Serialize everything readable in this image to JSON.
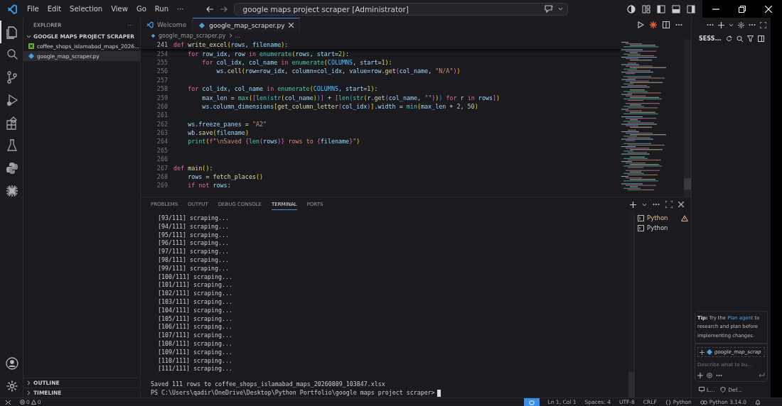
{
  "title_bar": {
    "menus": [
      "File",
      "Edit",
      "Selection",
      "View",
      "Go",
      "Run",
      "···"
    ],
    "search": "google maps project scraper [Administrator]"
  },
  "activity_bar": [
    {
      "kind": "files",
      "selected": true
    },
    {
      "kind": "search",
      "selected": false
    },
    {
      "kind": "branch",
      "selected": false
    },
    {
      "kind": "debug",
      "selected": false
    },
    {
      "kind": "blocks",
      "selected": false
    },
    {
      "kind": "flask",
      "selected": false
    },
    {
      "kind": "snake",
      "selected": false
    },
    {
      "kind": "burst",
      "selected": false
    }
  ],
  "explorer": {
    "title": "EXPLORER",
    "more": "···",
    "folder": {
      "label": "GOOGLE MAPS PROJECT SCRAPER",
      "expanded": true,
      "children": [
        {
          "label": "coffee_shops_islamabad_maps_2026...",
          "kind": "sheet",
          "selected": false
        },
        {
          "label": "google_map_scraper.py",
          "kind": "python",
          "selected": true
        }
      ]
    },
    "sections": [
      {
        "label": "OUTLINE",
        "expanded": false
      },
      {
        "label": "TIMELINE",
        "expanded": false
      }
    ]
  },
  "editor": {
    "tabs": [
      {
        "label": "Welcome",
        "kind": "welcome",
        "selected": false
      },
      {
        "label": "google_map_scraper.py",
        "kind": "python",
        "selected": true
      }
    ],
    "breadcrumb": [
      "google_map_scraper.py",
      "..."
    ],
    "sticky_line": {
      "number": "241",
      "tokens": [
        {
          "text": "def ",
          "kind": "kw"
        },
        {
          "text": "write_excel",
          "kind": "fn"
        },
        {
          "text": "(",
          "kind": "br1"
        },
        {
          "text": "rows",
          "kind": "param"
        },
        {
          "text": ", ",
          "kind": "plain"
        },
        {
          "text": "filename",
          "kind": "param"
        },
        {
          "text": ")",
          "kind": "br1"
        },
        {
          "text": ":",
          "kind": "plain"
        }
      ]
    },
    "lines": [
      {
        "number": "254",
        "tokens": [
          {
            "text": "    for",
            "kind": "kw"
          },
          {
            "text": " row_idx, row ",
            "kind": "var"
          },
          {
            "text": "in",
            "kind": "kw"
          },
          {
            "text": " enumerate",
            "kind": "builtin"
          },
          {
            "text": "(",
            "kind": "br1"
          },
          {
            "text": "rows",
            "kind": "var"
          },
          {
            "text": ", ",
            "kind": "plain"
          },
          {
            "text": "start",
            "kind": "param"
          },
          {
            "text": "=",
            "kind": "plain"
          },
          {
            "text": "2",
            "kind": "num"
          },
          {
            "text": ")",
            "kind": "br1"
          },
          {
            "text": ":",
            "kind": "plain"
          }
        ]
      },
      {
        "number": "255",
        "tokens": [
          {
            "text": "        for",
            "kind": "kw"
          },
          {
            "text": " col_idx, col_name ",
            "kind": "var"
          },
          {
            "text": "in",
            "kind": "kw"
          },
          {
            "text": " enumerate",
            "kind": "builtin"
          },
          {
            "text": "(",
            "kind": "br1"
          },
          {
            "text": "COLUMNS",
            "kind": "const"
          },
          {
            "text": ", ",
            "kind": "plain"
          },
          {
            "text": "start",
            "kind": "param"
          },
          {
            "text": "=",
            "kind": "plain"
          },
          {
            "text": "1",
            "kind": "num"
          },
          {
            "text": ")",
            "kind": "br1"
          },
          {
            "text": ":",
            "kind": "plain"
          }
        ]
      },
      {
        "number": "256",
        "tokens": [
          {
            "text": "            ws",
            "kind": "var"
          },
          {
            "text": ".",
            "kind": "plain"
          },
          {
            "text": "cell",
            "kind": "fn"
          },
          {
            "text": "(",
            "kind": "br1"
          },
          {
            "text": "row",
            "kind": "param"
          },
          {
            "text": "=",
            "kind": "plain"
          },
          {
            "text": "row_idx",
            "kind": "var"
          },
          {
            "text": ", ",
            "kind": "plain"
          },
          {
            "text": "column",
            "kind": "param"
          },
          {
            "text": "=",
            "kind": "plain"
          },
          {
            "text": "col_idx",
            "kind": "var"
          },
          {
            "text": ", ",
            "kind": "plain"
          },
          {
            "text": "value",
            "kind": "param"
          },
          {
            "text": "=",
            "kind": "plain"
          },
          {
            "text": "row",
            "kind": "var"
          },
          {
            "text": ".",
            "kind": "plain"
          },
          {
            "text": "get",
            "kind": "fn"
          },
          {
            "text": "(",
            "kind": "br2"
          },
          {
            "text": "col_name",
            "kind": "var"
          },
          {
            "text": ", ",
            "kind": "plain"
          },
          {
            "text": "\"N/A\"",
            "kind": "str"
          },
          {
            "text": ")",
            "kind": "br2"
          },
          {
            "text": ")",
            "kind": "br1"
          }
        ]
      },
      {
        "number": "257"
      },
      {
        "number": "258",
        "tokens": [
          {
            "text": "    for",
            "kind": "kw"
          },
          {
            "text": " col_idx, col_name ",
            "kind": "var"
          },
          {
            "text": "in",
            "kind": "kw"
          },
          {
            "text": " enumerate",
            "kind": "builtin"
          },
          {
            "text": "(",
            "kind": "br1"
          },
          {
            "text": "COLUMNS",
            "kind": "const"
          },
          {
            "text": ", ",
            "kind": "plain"
          },
          {
            "text": "start",
            "kind": "param"
          },
          {
            "text": "=",
            "kind": "plain"
          },
          {
            "text": "1",
            "kind": "num"
          },
          {
            "text": ")",
            "kind": "br1"
          },
          {
            "text": ":",
            "kind": "plain"
          }
        ]
      },
      {
        "number": "259",
        "tokens": [
          {
            "text": "        max_len",
            "kind": "var"
          },
          {
            "text": " = ",
            "kind": "plain"
          },
          {
            "text": "max",
            "kind": "builtin"
          },
          {
            "text": "(",
            "kind": "br1"
          },
          {
            "text": "[",
            "kind": "br2"
          },
          {
            "text": "len",
            "kind": "builtin"
          },
          {
            "text": "(",
            "kind": "br3"
          },
          {
            "text": "str",
            "kind": "builtin"
          },
          {
            "text": "(",
            "kind": "br1"
          },
          {
            "text": "col_name",
            "kind": "var"
          },
          {
            "text": ")",
            "kind": "br1"
          },
          {
            "text": ")",
            "kind": "br3"
          },
          {
            "text": "]",
            "kind": "br2"
          },
          {
            "text": " + ",
            "kind": "plain"
          },
          {
            "text": "[",
            "kind": "br2"
          },
          {
            "text": "len",
            "kind": "builtin"
          },
          {
            "text": "(",
            "kind": "br3"
          },
          {
            "text": "str",
            "kind": "builtin"
          },
          {
            "text": "(",
            "kind": "br1"
          },
          {
            "text": "r",
            "kind": "var"
          },
          {
            "text": ".",
            "kind": "plain"
          },
          {
            "text": "get",
            "kind": "fn"
          },
          {
            "text": "(",
            "kind": "br2"
          },
          {
            "text": "col_name",
            "kind": "var"
          },
          {
            "text": ", ",
            "kind": "plain"
          },
          {
            "text": "\"\"",
            "kind": "str"
          },
          {
            "text": ")",
            "kind": "br2"
          },
          {
            "text": ")",
            "kind": "br1"
          },
          {
            "text": ")",
            "kind": "br3"
          },
          {
            "text": " for",
            "kind": "kw"
          },
          {
            "text": " r ",
            "kind": "var"
          },
          {
            "text": "in",
            "kind": "kw"
          },
          {
            "text": " rows",
            "kind": "var"
          },
          {
            "text": "]",
            "kind": "br2"
          },
          {
            "text": ")",
            "kind": "br1"
          }
        ]
      },
      {
        "number": "260",
        "tokens": [
          {
            "text": "        ws",
            "kind": "var"
          },
          {
            "text": ".",
            "kind": "plain"
          },
          {
            "text": "column_dimensions",
            "kind": "var"
          },
          {
            "text": "[",
            "kind": "br1"
          },
          {
            "text": "get_column_letter",
            "kind": "fn"
          },
          {
            "text": "(",
            "kind": "br2"
          },
          {
            "text": "col_idx",
            "kind": "var"
          },
          {
            "text": ")",
            "kind": "br2"
          },
          {
            "text": "]",
            "kind": "br1"
          },
          {
            "text": ".",
            "kind": "plain"
          },
          {
            "text": "width",
            "kind": "var"
          },
          {
            "text": " = ",
            "kind": "plain"
          },
          {
            "text": "min",
            "kind": "builtin"
          },
          {
            "text": "(",
            "kind": "br1"
          },
          {
            "text": "max_len",
            "kind": "var"
          },
          {
            "text": " + ",
            "kind": "plain"
          },
          {
            "text": "2",
            "kind": "num"
          },
          {
            "text": ", ",
            "kind": "plain"
          },
          {
            "text": "50",
            "kind": "num"
          },
          {
            "text": ")",
            "kind": "br1"
          }
        ]
      },
      {
        "number": "261"
      },
      {
        "number": "262",
        "tokens": [
          {
            "text": "    ws",
            "kind": "var"
          },
          {
            "text": ".",
            "kind": "plain"
          },
          {
            "text": "freeze_panes",
            "kind": "var"
          },
          {
            "text": " = ",
            "kind": "plain"
          },
          {
            "text": "\"A2\"",
            "kind": "str"
          }
        ]
      },
      {
        "number": "263",
        "tokens": [
          {
            "text": "    wb",
            "kind": "var"
          },
          {
            "text": ".",
            "kind": "plain"
          },
          {
            "text": "save",
            "kind": "fn"
          },
          {
            "text": "(",
            "kind": "br1"
          },
          {
            "text": "filename",
            "kind": "var"
          },
          {
            "text": ")",
            "kind": "br1"
          }
        ]
      },
      {
        "number": "264",
        "tokens": [
          {
            "text": "    print",
            "kind": "builtin"
          },
          {
            "text": "(",
            "kind": "br1"
          },
          {
            "text": "f",
            "kind": "kw"
          },
          {
            "text": "\"\\nSaved ",
            "kind": "str"
          },
          {
            "text": "{",
            "kind": "kw"
          },
          {
            "text": "len",
            "kind": "builtin"
          },
          {
            "text": "(",
            "kind": "br2"
          },
          {
            "text": "rows",
            "kind": "var"
          },
          {
            "text": ")",
            "kind": "br2"
          },
          {
            "text": "}",
            "kind": "kw"
          },
          {
            "text": " rows to ",
            "kind": "str"
          },
          {
            "text": "{",
            "kind": "kw"
          },
          {
            "text": "filename",
            "kind": "var"
          },
          {
            "text": "}",
            "kind": "kw"
          },
          {
            "text": "\"",
            "kind": "str"
          },
          {
            "text": ")",
            "kind": "br1"
          }
        ]
      },
      {
        "number": "265"
      },
      {
        "number": "266"
      },
      {
        "number": "267",
        "tokens": [
          {
            "text": "def ",
            "kind": "kw"
          },
          {
            "text": "main",
            "kind": "fn"
          },
          {
            "text": "(",
            "kind": "br1"
          },
          {
            "text": ")",
            "kind": "br1"
          },
          {
            "text": ":",
            "kind": "plain"
          }
        ]
      },
      {
        "number": "268",
        "tokens": [
          {
            "text": "    rows",
            "kind": "var"
          },
          {
            "text": " = ",
            "kind": "plain"
          },
          {
            "text": "fetch_places",
            "kind": "fn"
          },
          {
            "text": "(",
            "kind": "br1"
          },
          {
            "text": ")",
            "kind": "br1"
          }
        ]
      },
      {
        "number": "269",
        "tokens": [
          {
            "text": "    if",
            "kind": "kw"
          },
          {
            "text": " not",
            "kind": "kw"
          },
          {
            "text": " rows",
            "kind": "var"
          },
          {
            "text": ":",
            "kind": "plain"
          }
        ]
      }
    ]
  },
  "panel": {
    "tabs": [
      {
        "label": "PROBLEMS",
        "selected": false
      },
      {
        "label": "OUTPUT",
        "selected": false
      },
      {
        "label": "DEBUG CONSOLE",
        "selected": false
      },
      {
        "label": "TERMINAL",
        "selected": true
      },
      {
        "label": "PORTS",
        "selected": false
      }
    ],
    "terminal_lines": [
      "  [93/111] scraping...",
      "  [94/111] scraping...",
      "  [95/111] scraping...",
      "  [96/111] scraping...",
      "  [97/111] scraping...",
      "  [98/111] scraping...",
      "  [99/111] scraping...",
      "  [100/111] scraping...",
      "  [101/111] scraping...",
      "  [102/111] scraping...",
      "  [103/111] scraping...",
      "  [104/111] scraping...",
      "  [105/111] scraping...",
      "  [106/111] scraping...",
      "  [107/111] scraping...",
      "  [108/111] scraping...",
      "  [109/111] scraping...",
      "  [110/111] scraping...",
      "  [111/111] scraping..."
    ],
    "saved_line": "Saved 111 rows to coffee_shops_islamabad_maps_20260809_103847.xlsx",
    "prompt": "PS C:\\Users\\qadir\\OneDrive\\Desktop\\Python Portfolio\\google maps project scraper>",
    "sessions": [
      {
        "label": "Python",
        "warning": true
      },
      {
        "label": "Python",
        "warning": false
      }
    ]
  },
  "chat": {
    "title": "SESS...",
    "tip": "**Tip:** Try the ",
    "tip_link": "Plan agent",
    "tip_after": " to research and plan before implementing changes.",
    "context_chip": "google_map_scrap",
    "placeholder": "Describe what to bu...",
    "footer": [
      "L...",
      "Def..."
    ]
  },
  "status_bar": {
    "errors": "0",
    "warnings": "0",
    "items": [
      {
        "text": "Ln 1, Col 1",
        "kind": "plain"
      },
      {
        "text": "Spaces: 4",
        "kind": "plain"
      },
      {
        "text": "UTF-8",
        "kind": "plain"
      },
      {
        "text": "CRLF",
        "kind": "plain"
      },
      {
        "text": "Python",
        "kind": "braces"
      },
      {
        "text": "Python 3.14.0",
        "kind": "copilot"
      }
    ]
  }
}
